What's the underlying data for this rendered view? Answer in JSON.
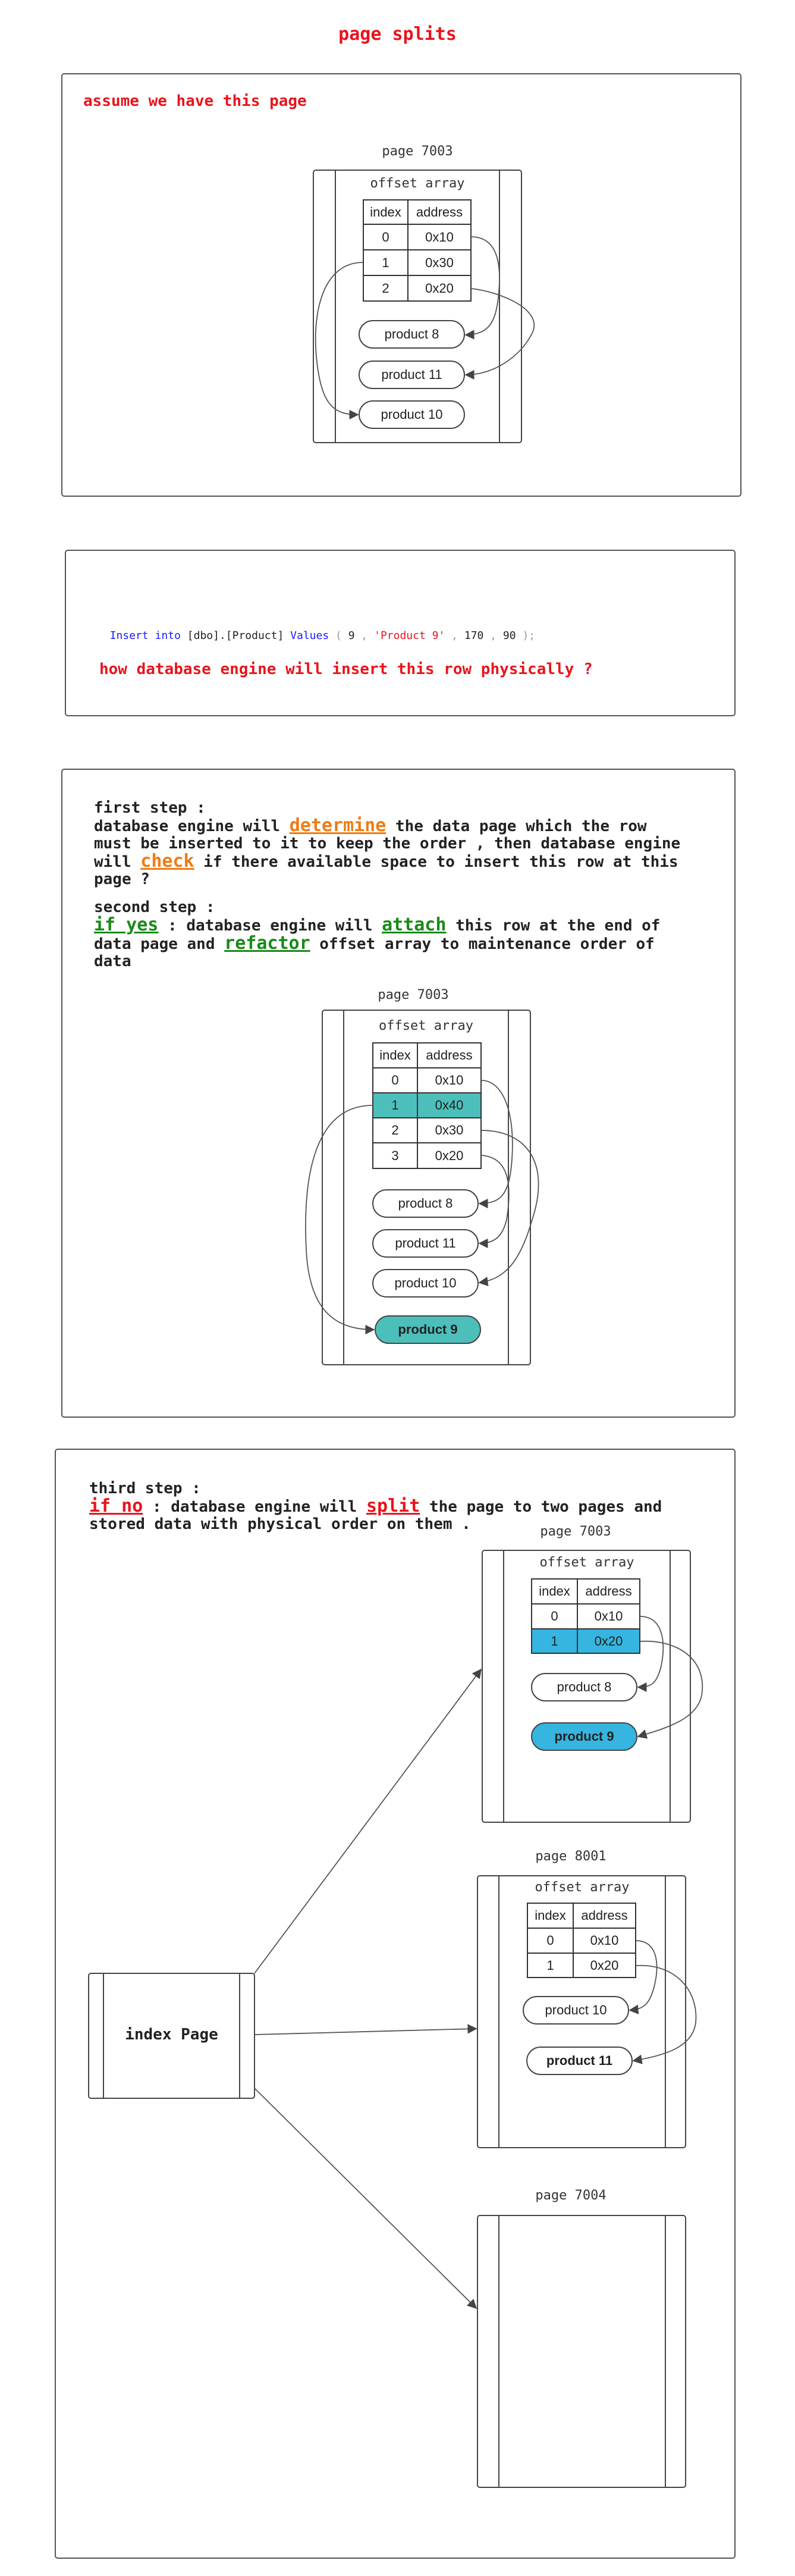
{
  "title": "page splits",
  "section1": {
    "heading": "assume we have this page",
    "page_label": "page 7003",
    "offset_label": "offset array",
    "table": {
      "headers": [
        "index",
        "address"
      ],
      "rows": [
        [
          "0",
          "0x10"
        ],
        [
          "1",
          "0x30"
        ],
        [
          "2",
          "0x20"
        ]
      ]
    },
    "products": [
      "product 8",
      "product 11",
      "product 10"
    ]
  },
  "section2": {
    "sql": {
      "kw_insert": "Insert",
      "kw_into": "into",
      "table_ref": "[dbo].[Product]",
      "kw_values": "Values",
      "open": "(",
      "v1": "9",
      "v2": "'Product 9'",
      "v3": "170",
      "v4": "90",
      "close": ");",
      "comma": ","
    },
    "question": "how database engine will insert this row physically ?"
  },
  "section3": {
    "step1_head": "first step :",
    "step1_a": "database engine will ",
    "step1_determine": "determine",
    "step1_b": " the data page which the row",
    "step1_line2": "must be inserted to it to keep the order , then database engine",
    "step1_c": "will ",
    "step1_check": "check",
    "step1_d": " if there available space to insert this row at this",
    "step1_line4": "page ?",
    "step2_head": "second step :",
    "step2_ifyes": "if yes",
    "step2_a": " : database engine will ",
    "step2_attach": "attach",
    "step2_b": " this row at the end of",
    "step2_c": "data page and ",
    "step2_refactor": "refactor",
    "step2_d": " offset array to maintenance order of",
    "step2_line3": "data",
    "page_label": "page 7003",
    "offset_label": "offset array",
    "table": {
      "headers": [
        "index",
        "address"
      ],
      "rows": [
        [
          "0",
          "0x10"
        ],
        [
          "1",
          "0x40"
        ],
        [
          "2",
          "0x30"
        ],
        [
          "3",
          "0x20"
        ]
      ]
    },
    "products": [
      "product 8",
      "product 11",
      "product 10",
      "product 9"
    ]
  },
  "section4": {
    "step3_head": "third step :",
    "step3_ifno": "if no",
    "step3_a": " : database engine will ",
    "step3_split": "split",
    "step3_b": " the page to two pages and",
    "step3_line2": "stored data with physical order on them .",
    "index_page": "index Page",
    "pageA": {
      "label": "page 7003",
      "offset_label": "offset array",
      "headers": [
        "index",
        "address"
      ],
      "rows": [
        [
          "0",
          "0x10"
        ],
        [
          "1",
          "0x20"
        ]
      ],
      "products": [
        "product 8",
        "product 9"
      ]
    },
    "pageB": {
      "label": "page 8001",
      "offset_label": "offset array",
      "headers": [
        "index",
        "address"
      ],
      "rows": [
        [
          "0",
          "0x10"
        ],
        [
          "1",
          "0x20"
        ]
      ],
      "products": [
        "product 10",
        "product 11"
      ]
    },
    "pageC": {
      "label": "page 7004"
    }
  },
  "colors": {
    "title_red": "#e8141c",
    "orange": "#f07b16",
    "green": "#1a8a1a",
    "teal": "#4dbfbb",
    "blue": "#35b5df",
    "line": "#444444",
    "sql_keyword": "#1a1aff",
    "sql_string": "#e8141c"
  }
}
